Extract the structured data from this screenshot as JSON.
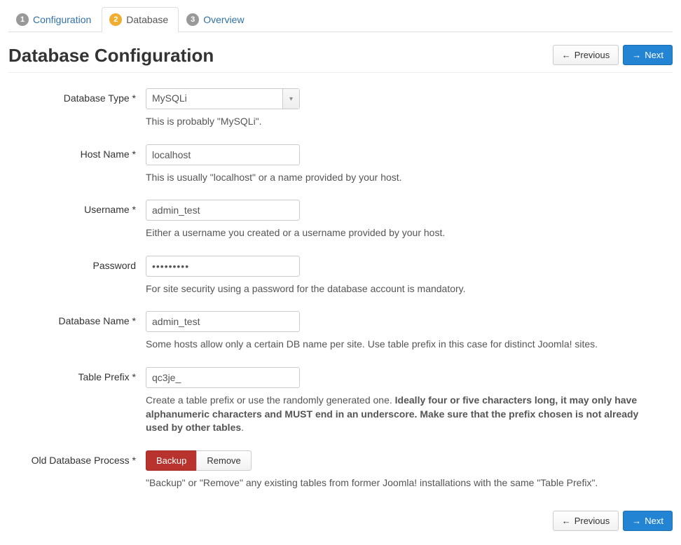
{
  "tabs": {
    "t1_num": "1",
    "t1_label": "Configuration",
    "t2_num": "2",
    "t2_label": "Database",
    "t3_num": "3",
    "t3_label": "Overview"
  },
  "page_title": "Database Configuration",
  "buttons": {
    "prev": "Previous",
    "next": "Next"
  },
  "fields": {
    "dbtype": {
      "label": "Database Type *",
      "value": "MySQLi",
      "help": "This is probably \"MySQLi\"."
    },
    "host": {
      "label": "Host Name *",
      "value": "localhost",
      "help": "This is usually \"localhost\" or a name provided by your host."
    },
    "user": {
      "label": "Username *",
      "value": "admin_test",
      "help": "Either a username you created or a username provided by your host."
    },
    "pass": {
      "label": "Password",
      "value": "•••••••••",
      "help": "For site security using a password for the database account is mandatory."
    },
    "dbname": {
      "label": "Database Name *",
      "value": "admin_test",
      "help": "Some hosts allow only a certain DB name per site. Use table prefix in this case for distinct Joomla! sites."
    },
    "prefix": {
      "label": "Table Prefix *",
      "value": "qc3je_",
      "help_plain": "Create a table prefix or use the randomly generated one. ",
      "help_bold": "Ideally four or five characters long, it may only have alphanumeric characters and MUST end in an underscore. Make sure that the prefix chosen is not already used by other tables",
      "help_tail": "."
    },
    "oldproc": {
      "label": "Old Database Process *",
      "opt_backup": "Backup",
      "opt_remove": "Remove",
      "help": "\"Backup\" or \"Remove\" any existing tables from former Joomla! installations with the same \"Table Prefix\"."
    }
  }
}
